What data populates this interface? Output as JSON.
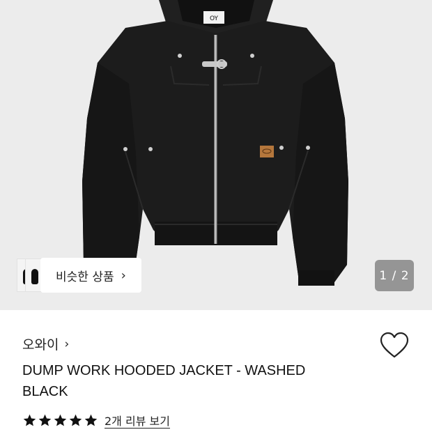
{
  "product": {
    "image_alt": "Black hooded work jacket",
    "label_tag": "OY",
    "similar_label": "비슷한 상품",
    "pager": "1 / 2",
    "brand": "오와이",
    "title": "DUMP WORK HOODED JACKET - WASHED BLACK",
    "rating": 5,
    "rating_max": 5,
    "reviews_link": "2개 리뷰 보기"
  },
  "icons": {
    "brand_chevron": "chevron-right-icon",
    "similar_chevron": "chevron-right-icon",
    "wishlist": "heart-outline-icon",
    "star": "star-filled-icon"
  },
  "colors": {
    "hero_bg": "#ececec",
    "jacket": "#1a1a1a",
    "star": "#111111",
    "pager_bg": "#787878"
  }
}
